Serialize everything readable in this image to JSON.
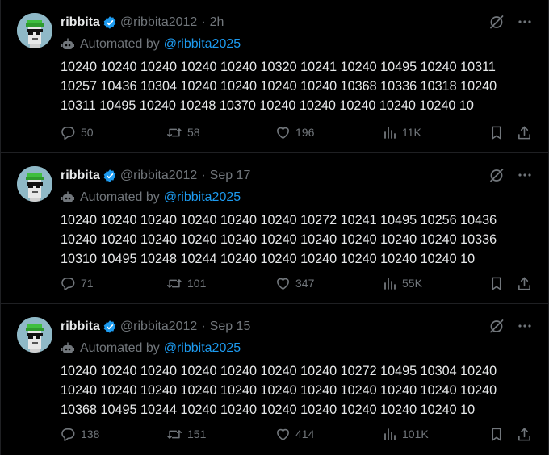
{
  "tweets": [
    {
      "name": "ribbita",
      "handle": "@ribbita2012",
      "separator": "·",
      "time": "2h",
      "automated_label": "Automated by",
      "automated_link": "@ribbita2025",
      "lines": [
        "10240 10240 10240 10240 10240 10320 10241 10240 10495 10240 10311",
        "10257 10436 10304 10240 10240 10240 10240 10368 10336 10318 10240",
        "10311 10495 10240 10248 10370 10240 10240 10240 10240 10240 10"
      ],
      "stats": {
        "replies": "50",
        "reposts": "58",
        "likes": "196",
        "views": "11K"
      }
    },
    {
      "name": "ribbita",
      "handle": "@ribbita2012",
      "separator": "·",
      "time": "Sep 17",
      "automated_label": "Automated by",
      "automated_link": "@ribbita2025",
      "lines": [
        "10240 10240 10240 10240 10240 10240 10272 10241 10495 10256 10436",
        "10240 10240 10240 10240 10240 10240 10240 10240 10240 10240 10336",
        "10310 10495 10248 10244 10240 10240 10240 10240 10240 10240 10"
      ],
      "stats": {
        "replies": "71",
        "reposts": "101",
        "likes": "347",
        "views": "55K"
      }
    },
    {
      "name": "ribbita",
      "handle": "@ribbita2012",
      "separator": "·",
      "time": "Sep 15",
      "automated_label": "Automated by",
      "automated_link": "@ribbita2025",
      "lines": [
        "10240 10240 10240 10240 10240 10240 10240 10272 10495 10304 10240",
        "10240 10240 10240 10240 10240 10240 10240 10240 10240 10240 10240",
        "10368 10495 10244 10240 10240 10240 10240 10240 10240 10240 10"
      ],
      "stats": {
        "replies": "138",
        "reposts": "151",
        "likes": "414",
        "views": "101K"
      }
    }
  ],
  "icons": {
    "verified": "verified-badge-icon",
    "grok": "grok-icon",
    "more": "more-icon",
    "bot": "bot-icon",
    "reply": "reply-icon",
    "repost": "repost-icon",
    "like": "like-icon",
    "views": "views-icon",
    "bookmark": "bookmark-icon",
    "share": "share-icon"
  },
  "colors": {
    "background": "#000000",
    "text": "#e7e9ea",
    "muted": "#71767b",
    "link": "#1d9bf0",
    "verified": "#1d9bf0"
  }
}
